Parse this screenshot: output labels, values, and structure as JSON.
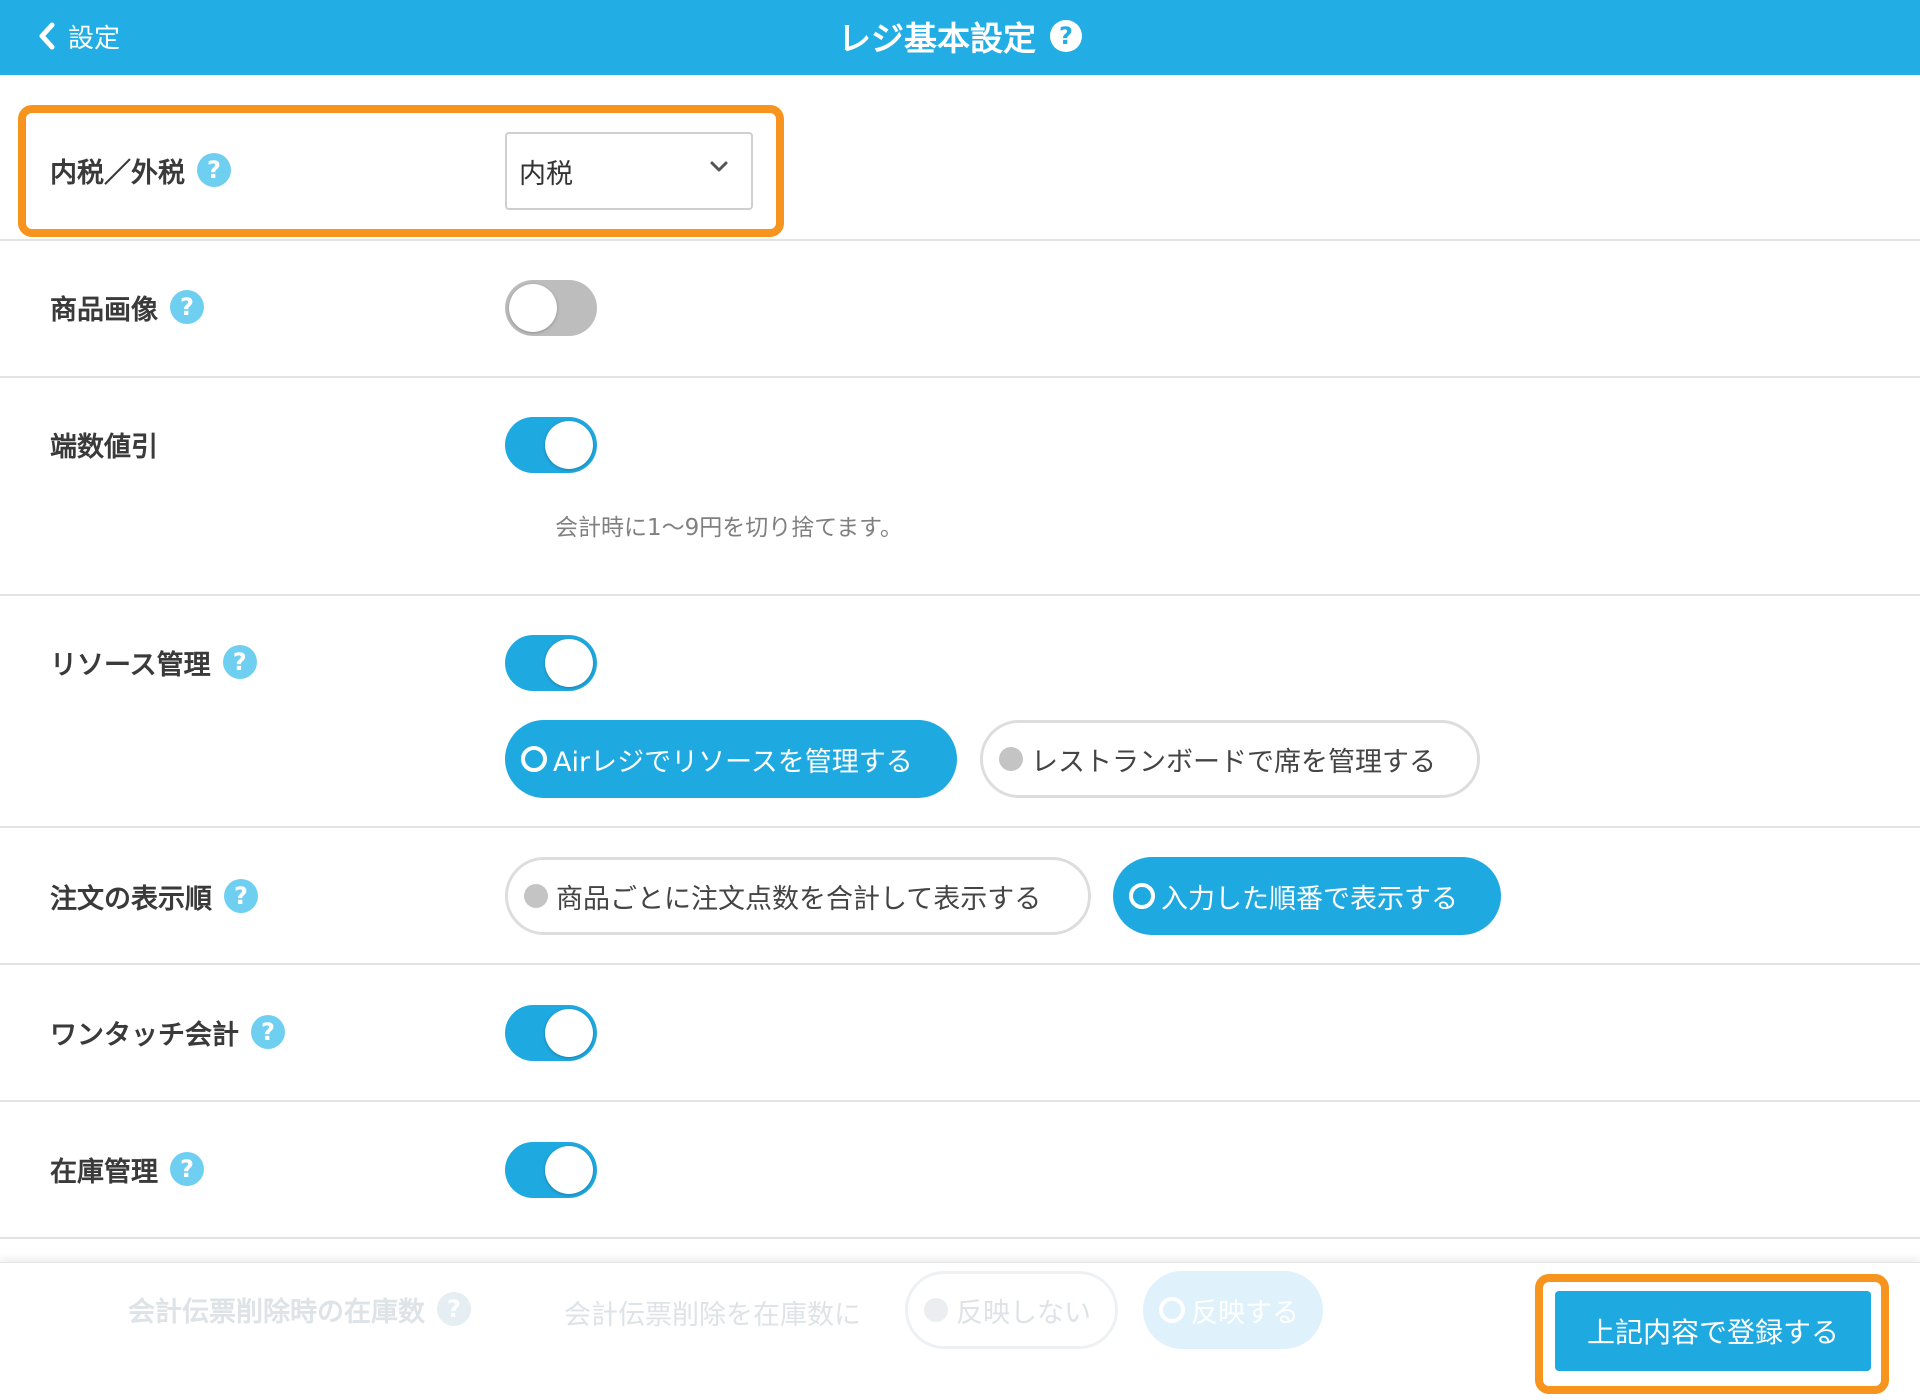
{
  "header": {
    "back_label": "設定",
    "title": "レジ基本設定",
    "help": "?"
  },
  "settings": {
    "tax": {
      "label": "内税／外税",
      "help": "?",
      "selected": "内税"
    },
    "product_image": {
      "label": "商品画像",
      "help": "?",
      "enabled": false
    },
    "rounding_discount": {
      "label": "端数値引",
      "enabled": true,
      "note": "会計時に1〜9円を切り捨てます。"
    },
    "resource_management": {
      "label": "リソース管理",
      "help": "?",
      "enabled": true,
      "options": [
        "Airレジでリソースを管理する",
        "レストランボードで席を管理する"
      ],
      "selected_index": 0
    },
    "order_display": {
      "label": "注文の表示順",
      "help": "?",
      "options": [
        "商品ごとに注文点数を合計して表示する",
        "入力した順番で表示する"
      ],
      "selected_index": 1
    },
    "one_touch_checkout": {
      "label": "ワンタッチ会計",
      "help": "?",
      "enabled": true
    },
    "inventory_management": {
      "label": "在庫管理",
      "help": "?",
      "enabled": true
    }
  },
  "footer": {
    "faded_label": "会計伝票削除時の在庫数",
    "faded_help": "?",
    "faded_prompt": "会計伝票削除を在庫数に",
    "faded_options": [
      "反映しない",
      "反映する"
    ],
    "submit_label": "上記内容で登録する"
  },
  "colors": {
    "header": "#22aee4",
    "accent": "#1fa9e1",
    "highlight": "#f7941d"
  }
}
